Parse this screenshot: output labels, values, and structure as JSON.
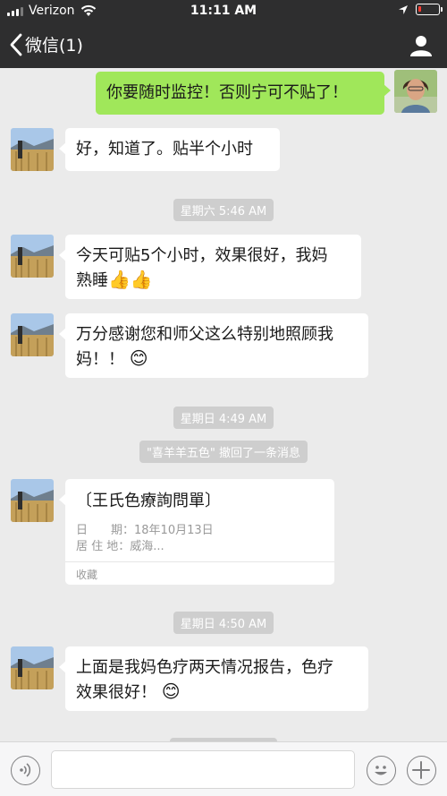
{
  "status_bar": {
    "carrier": "Verizon",
    "time": "11:11 AM",
    "battery_level": 0.15,
    "battery_color": "#ff3b30"
  },
  "nav": {
    "back_label": "微信(1)",
    "back_icon": "chevron-left-icon",
    "profile_icon": "person-icon"
  },
  "messages": {
    "m1": "你要随时监控！否则宁可不贴了！",
    "m2": "好，知道了。贴半个小时",
    "t1": "星期六 5:46 AM",
    "m3_line1": "今天可贴5个小时，效果很好，我妈",
    "m3_line2": "熟睡",
    "m3_emoji": "👍👍",
    "m4_line1": "万分感谢您和师父这么特别地照顾我",
    "m4_line2": "妈！！",
    "m4_emoji": "😊",
    "t2": "星期日 4:49 AM",
    "recall": "\"喜羊羊五色\" 撤回了一条消息",
    "card_title": "〔王氏色療詢問單〕",
    "card_line1": "日　　期：18年10月13日",
    "card_line2": "居 住 地：威海...",
    "card_footer": "收藏",
    "t3": "星期日 4:50 AM",
    "m5_line1": "上面是我妈色疗两天情况报告，色疗",
    "m5_line2": "效果很好！",
    "m5_emoji": "😊"
  },
  "colors": {
    "bar_dark": "#2e2e2f",
    "chat_bg": "#ebebeb",
    "my_bubble": "#a0e75a",
    "their_bubble": "#ffffff"
  }
}
